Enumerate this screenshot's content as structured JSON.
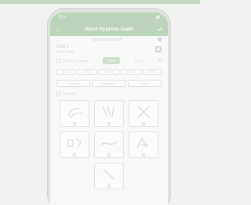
{
  "status": {
    "time": "12:4",
    "signal": "◢▮"
  },
  "appbar": {
    "title": "Hand Hygiene Audit",
    "back_icon": "arrow-left-icon",
    "check_icon": "check-icon"
  },
  "subtabs": {
    "left": "",
    "center": "OBSERVATION OBS",
    "right": ""
  },
  "form": {
    "staff_label": "Staff 1",
    "staff_sub": "Nurse (Staff)",
    "ppe_label": "PPE/Gel Changed",
    "done_label": "Done",
    "counter": "(0/10)",
    "undo_icon": "undo-icon",
    "select_all_label": "Select All"
  },
  "moments": [
    "MT 01",
    "MT 02",
    "MT 03",
    "MT 04",
    "MT 05"
  ],
  "roles": [
    "HandRub",
    "HandWash",
    "Missed"
  ],
  "steps": [
    {
      "name": "step-1",
      "label": ""
    },
    {
      "name": "step-2",
      "label": ""
    },
    {
      "name": "step-3",
      "label": ""
    },
    {
      "name": "step-4",
      "label": ""
    },
    {
      "name": "step-5",
      "label": ""
    },
    {
      "name": "step-6",
      "label": ""
    },
    {
      "name": "step-7",
      "label": ""
    }
  ]
}
